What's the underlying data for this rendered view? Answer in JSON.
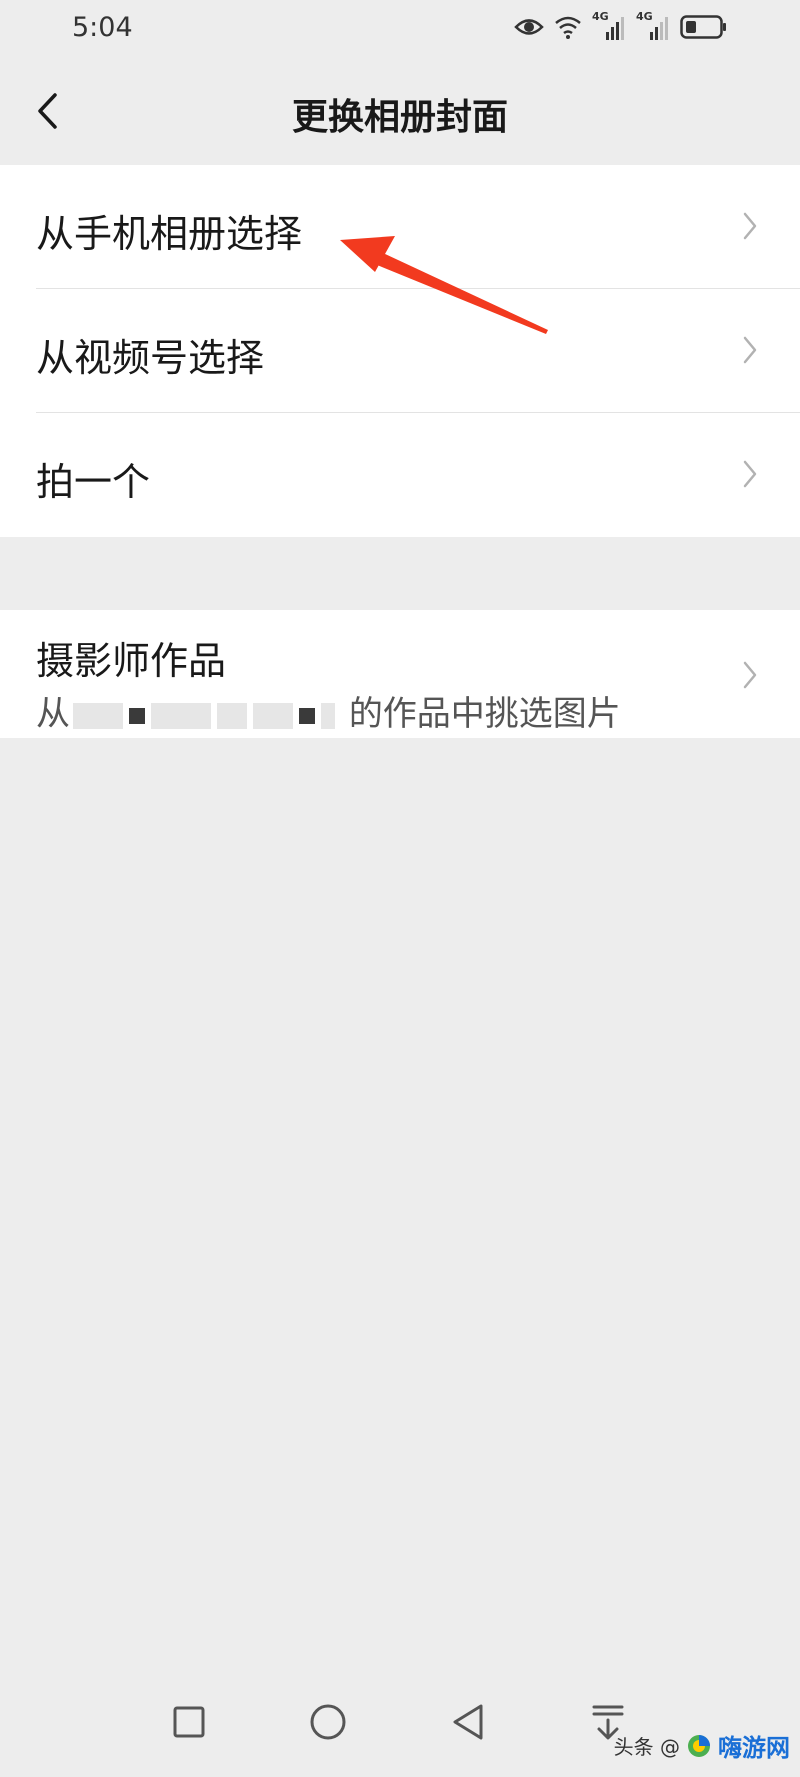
{
  "status_bar": {
    "time": "5:04",
    "network_1": "4G",
    "network_2": "4G"
  },
  "nav": {
    "title": "更换相册封面"
  },
  "menu_group_1": {
    "items": [
      {
        "label": "从手机相册选择"
      },
      {
        "label": "从视频号选择"
      },
      {
        "label": "拍一个"
      }
    ]
  },
  "menu_group_2": {
    "title": "摄影师作品",
    "subtitle_prefix": "从",
    "subtitle_suffix": "的作品中挑选图片"
  },
  "watermark": {
    "text": "头条 @",
    "brand": "嗨游网"
  },
  "colors": {
    "background": "#ededed",
    "card": "#ffffff",
    "annotation_arrow": "#f23a1f",
    "watermark_brand": "#1a6fd6"
  }
}
